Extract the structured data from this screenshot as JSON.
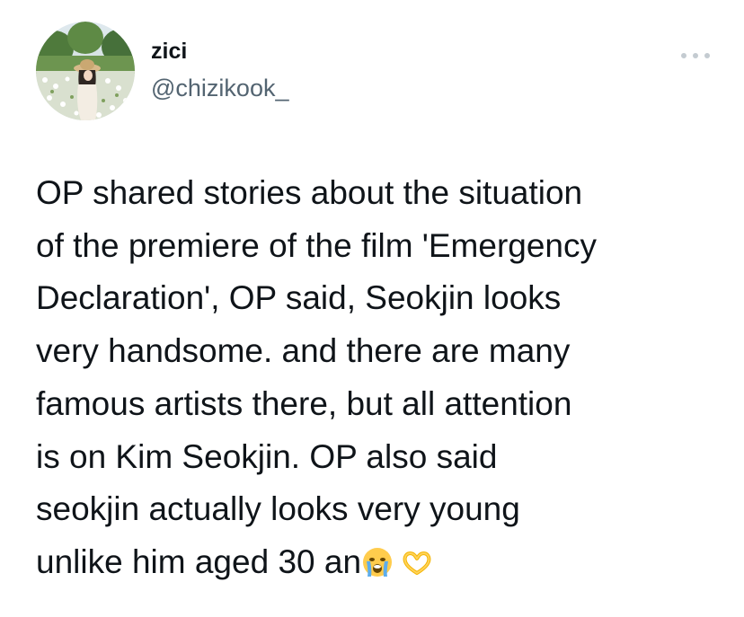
{
  "user": {
    "display_name": "zici",
    "handle": "@chizikook_",
    "avatar_icon": "avatar-photo-icon"
  },
  "menu": {
    "more_icon": "more-options-icon"
  },
  "tweet": {
    "lines": [
      "OP shared stories about the situation",
      "of the premiere of the film 'Emergency",
      "Declaration', OP said, Seokjin looks",
      "very handsome. and there are many",
      "famous artists there, but all attention",
      "is on Kim Seokjin. OP also said",
      "seokjin actually looks very young",
      "unlike him aged  30 an"
    ],
    "emojis": [
      "crying-face-emoji",
      "heart-hands-emoji"
    ]
  },
  "colors": {
    "text": "#0f1419",
    "secondary": "#536471",
    "dots": "#c4cbd1"
  }
}
